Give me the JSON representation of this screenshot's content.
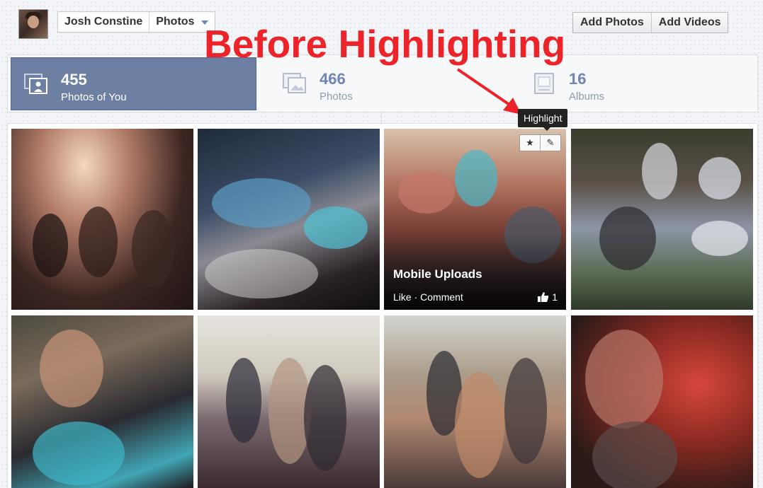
{
  "header": {
    "profile_name": "Josh Constine",
    "section": "Photos",
    "buttons": {
      "add_photos": "Add Photos",
      "add_videos": "Add Videos"
    }
  },
  "annotation": {
    "text": "Before Highlighting",
    "color": "#ec2329"
  },
  "stats": [
    {
      "count": "455",
      "label": "Photos of You",
      "icon": "photo-of-you-icon",
      "active": true
    },
    {
      "count": "466",
      "label": "Photos",
      "icon": "photos-icon",
      "active": false
    },
    {
      "count": "16",
      "label": "Albums",
      "icon": "album-icon",
      "active": false
    }
  ],
  "tooltip": {
    "text": "Highlight"
  },
  "hovered_photo": {
    "title": "Mobile Uploads",
    "like": "Like",
    "separator": "·",
    "comment": "Comment",
    "like_count": "1",
    "tools": [
      "star-icon",
      "pencil-icon"
    ]
  },
  "colors": {
    "accent": "#6d84b4",
    "active_tab": "#6d7fa3"
  }
}
